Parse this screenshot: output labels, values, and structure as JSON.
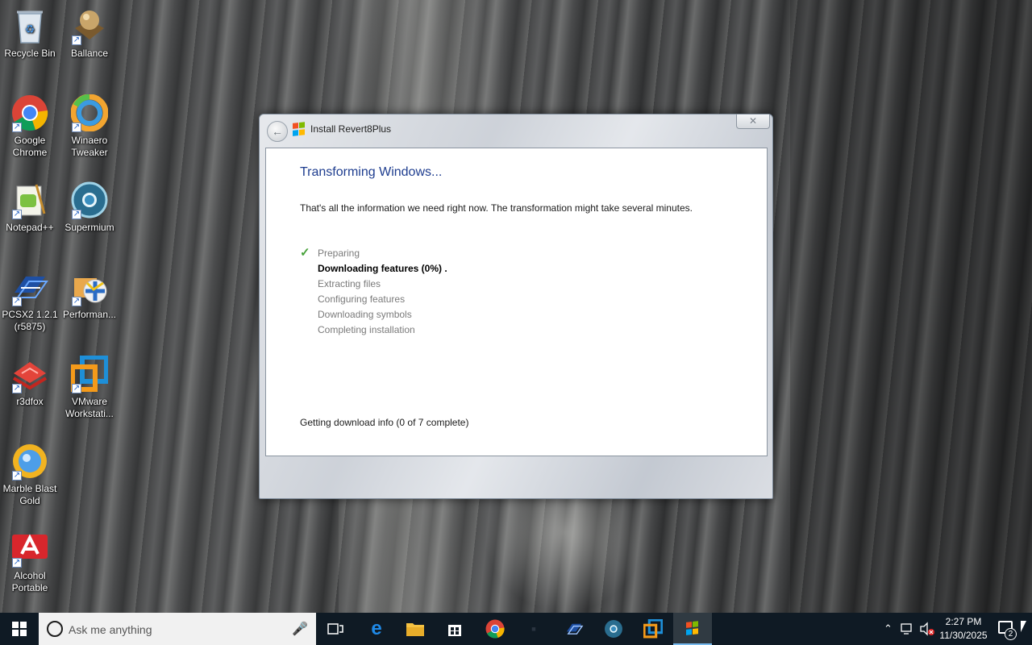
{
  "desktop": {
    "icons": [
      {
        "label": "Recycle Bin",
        "icon": "recycle-bin-icon",
        "glyph": "🗑"
      },
      {
        "label": "Ballance",
        "icon": "ballance-icon",
        "glyph": "●"
      },
      {
        "label": "Google Chrome",
        "icon": "chrome-icon",
        "glyph": ""
      },
      {
        "label": "Winaero Tweaker",
        "icon": "winaero-tweaker-icon",
        "glyph": ""
      },
      {
        "label": "Notepad++",
        "icon": "notepad-plus-plus-icon",
        "glyph": "✎"
      },
      {
        "label": "Supermium",
        "icon": "supermium-icon",
        "glyph": ""
      },
      {
        "label": "PCSX2 1.2.1 (r5875)",
        "icon": "pcsx2-icon",
        "glyph": "≋"
      },
      {
        "label": "Performan...",
        "icon": "performance-icon",
        "glyph": "✦"
      },
      {
        "label": "r3dfox",
        "icon": "r3dfox-icon",
        "glyph": "◆"
      },
      {
        "label": "VMware Workstati...",
        "icon": "vmware-icon",
        "glyph": ""
      },
      {
        "label": "Marble Blast Gold",
        "icon": "marble-blast-icon",
        "glyph": "☀"
      },
      {
        "label": "Alcohol Portable",
        "icon": "alcohol-portable-icon",
        "glyph": "A"
      }
    ]
  },
  "window": {
    "title": "Install Revert8Plus",
    "back_glyph": "←",
    "close_glyph": "✕",
    "heading": "Transforming Windows...",
    "info": "That's all the information we need right now. The transformation might take several minutes.",
    "steps": [
      {
        "label": "Preparing",
        "state": "done"
      },
      {
        "label": "Downloading features (0%) .",
        "state": "active"
      },
      {
        "label": "Extracting files",
        "state": "pending"
      },
      {
        "label": "Configuring features",
        "state": "pending"
      },
      {
        "label": "Downloading symbols",
        "state": "pending"
      },
      {
        "label": "Completing installation",
        "state": "pending"
      }
    ],
    "status": "Getting download info (0 of 7 complete)"
  },
  "taskbar": {
    "search_placeholder": "Ask me anything",
    "clock_time": "2:27 PM",
    "clock_date": "11/30/2025",
    "notification_count": "2"
  },
  "colors": {
    "heading": "#1e3d8f",
    "check": "#47a23a",
    "taskbar": "#0f1a24"
  }
}
